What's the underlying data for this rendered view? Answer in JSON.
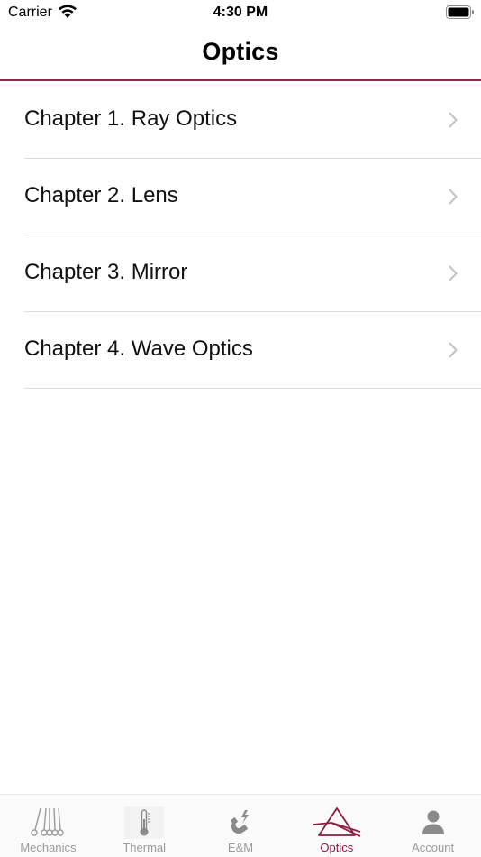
{
  "status_bar": {
    "carrier": "Carrier",
    "time": "4:30 PM"
  },
  "nav": {
    "title": "Optics"
  },
  "chapters": [
    {
      "label": "Chapter 1. Ray Optics"
    },
    {
      "label": "Chapter 2. Lens"
    },
    {
      "label": "Chapter 3. Mirror"
    },
    {
      "label": "Chapter 4. Wave Optics"
    }
  ],
  "tabs": [
    {
      "label": "Mechanics",
      "icon": "newtons-cradle-icon",
      "active": false
    },
    {
      "label": "Thermal",
      "icon": "thermometer-icon",
      "active": false
    },
    {
      "label": "E&M",
      "icon": "magnet-icon",
      "active": false
    },
    {
      "label": "Optics",
      "icon": "prism-icon",
      "active": true
    },
    {
      "label": "Account",
      "icon": "person-icon",
      "active": false
    }
  ],
  "colors": {
    "accent": "#8a1d42",
    "inactive_tab": "#9a9a9a",
    "separator": "#dcdcdc"
  }
}
